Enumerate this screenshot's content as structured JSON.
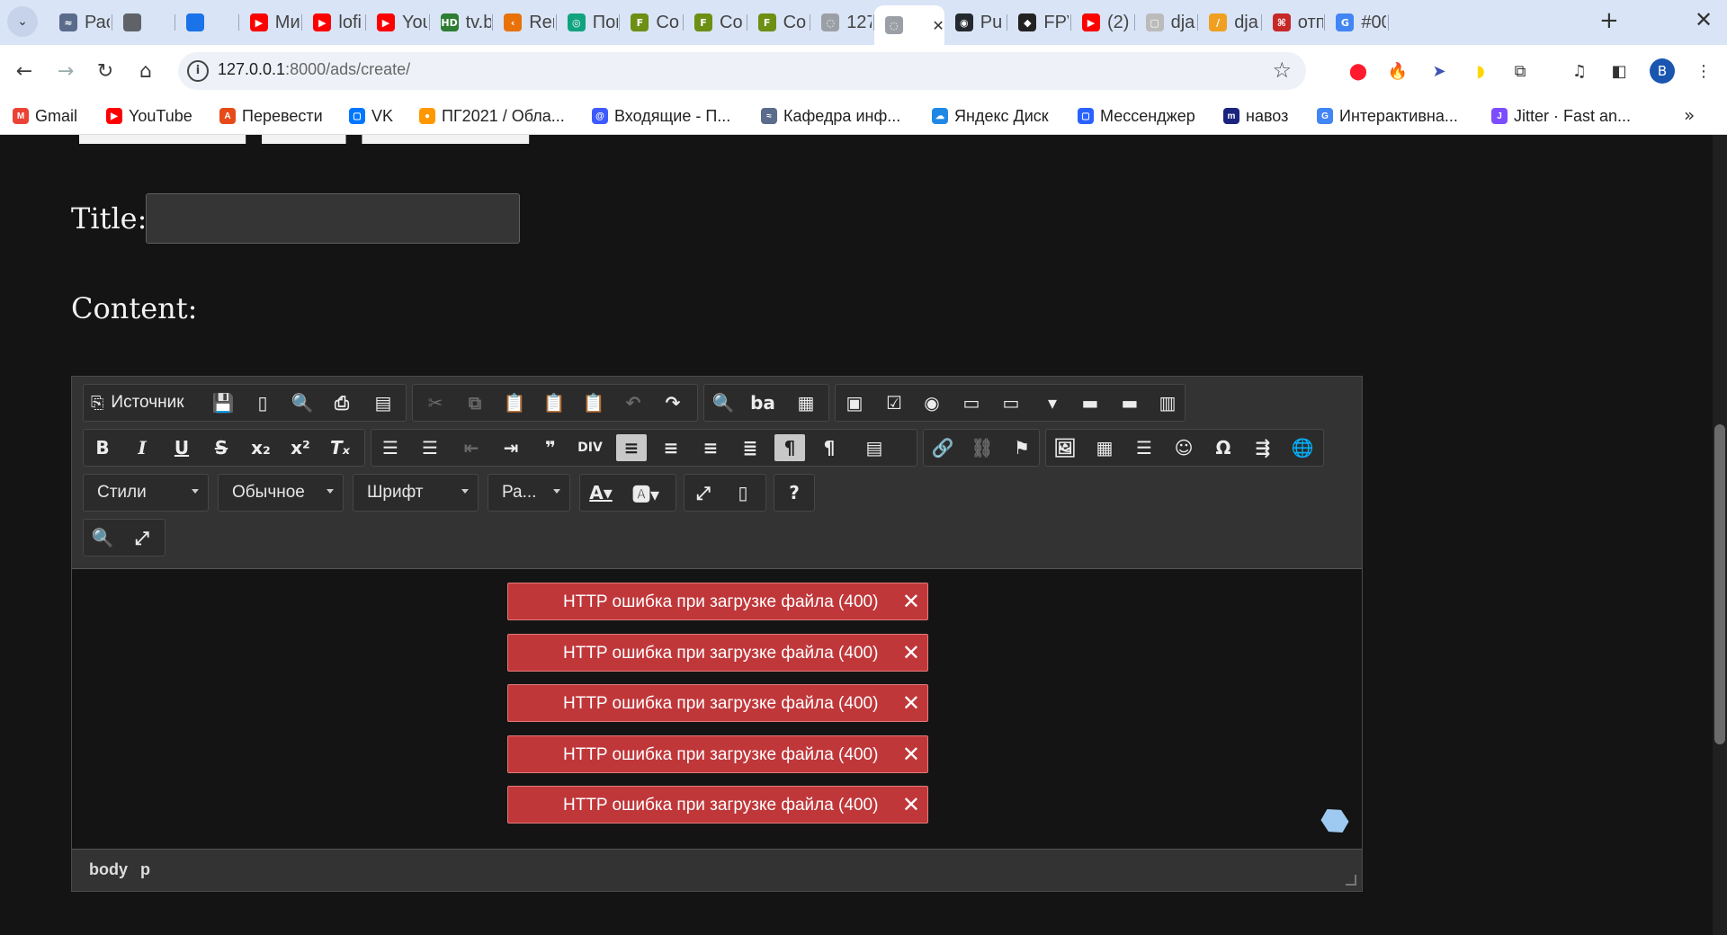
{
  "browser": {
    "tabs": [
      {
        "label": "Рас",
        "fav": "≈",
        "color": "#5a6b8c"
      },
      {
        "label": "",
        "fav": "",
        "color": "#5f6368"
      },
      {
        "label": "",
        "fav": "",
        "color": "#1a73e8"
      },
      {
        "label": "Ми",
        "fav": "▶",
        "color": "#ff0000"
      },
      {
        "label": "lofi",
        "fav": "▶",
        "color": "#ff0000"
      },
      {
        "label": "You",
        "fav": "▶",
        "color": "#ff0000"
      },
      {
        "label": "tv.b",
        "fav": "HD",
        "color": "#2e7d32"
      },
      {
        "label": "Ren",
        "fav": "‹",
        "color": "#e8710a"
      },
      {
        "label": "Пом",
        "fav": "◎",
        "color": "#10a37f"
      },
      {
        "label": "Со",
        "fav": "F",
        "color": "#6d8f13"
      },
      {
        "label": "Со",
        "fav": "F",
        "color": "#6d8f13"
      },
      {
        "label": "Со",
        "fav": "F",
        "color": "#6d8f13"
      },
      {
        "label": "127",
        "fav": "◌",
        "color": "#9aa0a6"
      },
      {
        "label": "",
        "fav": "◌",
        "color": "#9aa0a6",
        "active": true
      },
      {
        "label": "Pu",
        "fav": "◉",
        "color": "#24292f"
      },
      {
        "label": "FPV",
        "fav": "◆",
        "color": "#222"
      },
      {
        "label": "(2)",
        "fav": "▶",
        "color": "#ff0000"
      },
      {
        "label": "dja",
        "fav": "▢",
        "color": "#bbb"
      },
      {
        "label": "dja",
        "fav": "/",
        "color": "#f0a020"
      },
      {
        "label": "отп",
        "fav": "⌘",
        "color": "#c62828"
      },
      {
        "label": "#00",
        "fav": "G",
        "color": "#4285f4"
      }
    ],
    "new_tab": "+",
    "url_host": "127.0.0.1",
    "url_rest": ":8000/ads/create/",
    "bookmarks": [
      {
        "label": "Gmail",
        "ic": "M",
        "color": "#ea4335"
      },
      {
        "label": "YouTube",
        "ic": "▶",
        "color": "#ff0000"
      },
      {
        "label": "Перевести",
        "ic": "A",
        "color": "#e64a19"
      },
      {
        "label": "VK",
        "ic": "▢",
        "color": "#0077ff"
      },
      {
        "label": "ПГ2021 / Обла...",
        "ic": "●",
        "color": "#ff9800"
      },
      {
        "label": "Входящие - П...",
        "ic": "@",
        "color": "#3d5afe"
      },
      {
        "label": "Кафедра инф...",
        "ic": "≈",
        "color": "#5a6b8c"
      },
      {
        "label": "Яндекс Диск",
        "ic": "☁",
        "color": "#1e88e5"
      },
      {
        "label": "Мессенджер",
        "ic": "▢",
        "color": "#2962ff"
      },
      {
        "label": "навоз",
        "ic": "m",
        "color": "#1a237e"
      },
      {
        "label": "Интерактивна...",
        "ic": "G",
        "color": "#4285f4"
      },
      {
        "label": "Jitter · Fast an...",
        "ic": "J",
        "color": "#7c4dff"
      }
    ],
    "profile_initial": "B"
  },
  "form": {
    "title_label": "Title:",
    "content_label": "Content:",
    "title_value": ""
  },
  "editor": {
    "source_label": "Источник",
    "combos": [
      "Стили",
      "Обычное",
      "Шрифт",
      "Ра..."
    ],
    "errors": [
      "HTTP ошибка при загрузке файла (400)",
      "HTTP ошибка при загрузке файла (400)",
      "HTTP ошибка при загрузке файла (400)",
      "HTTP ошибка при загрузке файла (400)",
      "HTTP ошибка при загрузке файла (400)"
    ],
    "error_close": "✕",
    "path": [
      "body",
      "p"
    ]
  }
}
